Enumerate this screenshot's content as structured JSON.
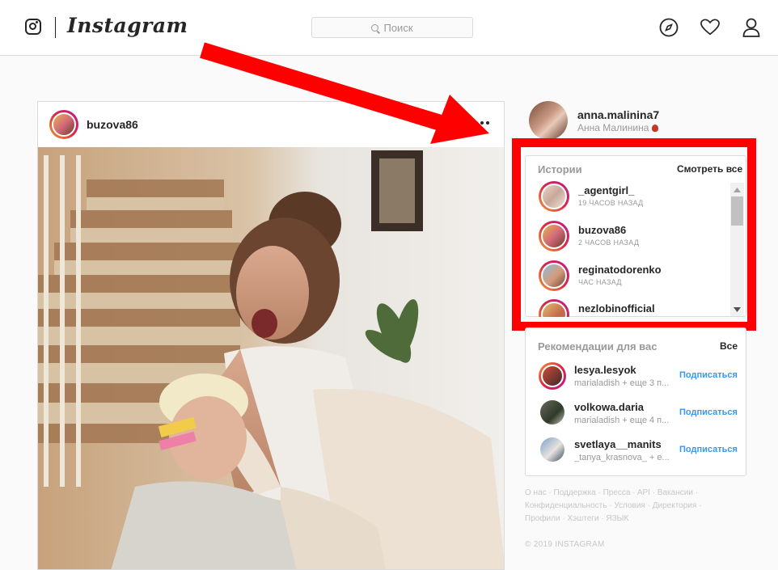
{
  "header": {
    "brand": "Instagram",
    "search_placeholder": "Поиск",
    "icons": [
      "instagram-logo-icon",
      "explore-compass-icon",
      "activity-heart-icon",
      "profile-person-icon"
    ]
  },
  "post": {
    "username": "buzova86",
    "more_icon": "more-dots-icon"
  },
  "current_user": {
    "username": "anna.malinina7",
    "full_name": "Анна Малинина"
  },
  "stories": {
    "title": "Истории",
    "see_all": "Смотреть все",
    "items": [
      {
        "username": "_agentgirl_",
        "time": "19 ЧАСОВ НАЗАД"
      },
      {
        "username": "buzova86",
        "time": "2 ЧАСОВ НАЗАД"
      },
      {
        "username": "reginatodorenko",
        "time": "ЧАС НАЗАД"
      },
      {
        "username": "nezlobinofficial",
        "time": ""
      }
    ]
  },
  "recommendations": {
    "title": "Рекомендации для вас",
    "see_all": "Все",
    "follow_label": "Подписаться",
    "items": [
      {
        "username": "lesya.lesyok",
        "subtitle": "marialadish + еще 3 п..."
      },
      {
        "username": "volkowa.daria",
        "subtitle": "marialadish + еще 4 п..."
      },
      {
        "username": "svetlaya__manits",
        "subtitle": "_tanya_krasnova_ + е..."
      }
    ]
  },
  "footer": {
    "links": [
      "О нас",
      "Поддержка",
      "Прессa",
      "API",
      "Вакансии",
      "Конфиденциальность",
      "Условия",
      "Директория",
      "Профили",
      "Хэштеги",
      "ЯЗЫК"
    ],
    "copyright": "© 2019 INSTAGRAM"
  },
  "colors": {
    "annotation_red": "#ff0000",
    "link_blue": "#3897f0"
  }
}
